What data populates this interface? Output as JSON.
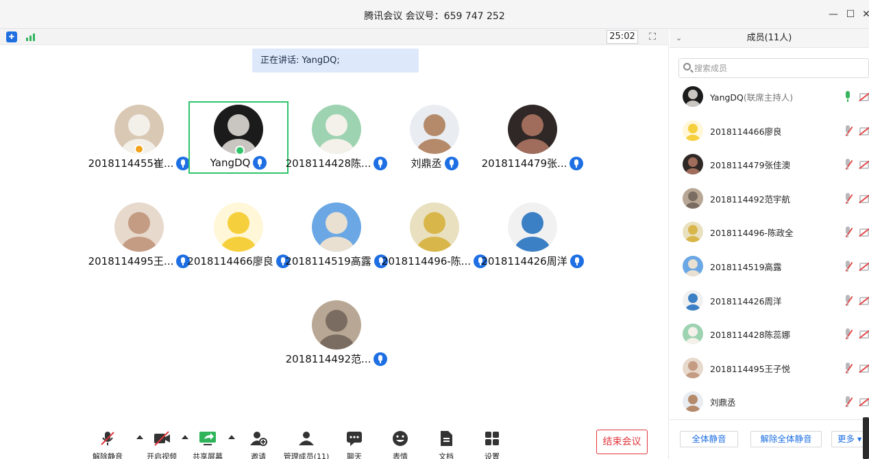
{
  "window": {
    "title": "腾讯会议 会议号：659 747 252"
  },
  "status": {
    "timer": "25:02",
    "speaking": "正在讲话: YangDQ;"
  },
  "tiles": [
    {
      "name": "2018114455崔...",
      "bg": "#d9c8b4",
      "fg": "#f3efe9",
      "badge": "#f2a31b"
    },
    {
      "name": "YangDQ",
      "bg": "#1b1b1b",
      "fg": "#c9c6c2",
      "badge": "#2fc36a"
    },
    {
      "name": "2018114428陈...",
      "bg": "#9dd3b1",
      "fg": "#f4f1ea"
    },
    {
      "name": "刘鼎丞",
      "bg": "#e9edf2",
      "fg": "#b48a6b"
    },
    {
      "name": "2018114479张...",
      "bg": "#2f2826",
      "fg": "#a06d5c"
    },
    {
      "name": "2018114495王...",
      "bg": "#e7d9cc",
      "fg": "#c49b83"
    },
    {
      "name": "2018114466廖良",
      "bg": "#fff7d8",
      "fg": "#f6cf3c"
    },
    {
      "name": "2018114519高露",
      "bg": "#6aa7e4",
      "fg": "#e9e0d2"
    },
    {
      "name": "2018114496-陈...",
      "bg": "#e9e0bf",
      "fg": "#d9b64a"
    },
    {
      "name": "2018114426周洋",
      "bg": "#f1f1f1",
      "fg": "#3b7fc4"
    },
    {
      "name": "2018114492范...",
      "bg": "#b8a794",
      "fg": "#7a6c60"
    }
  ],
  "toolbar": [
    {
      "label": "解除静音",
      "icon": "mic-muted-icon"
    },
    {
      "label": "开启视频",
      "icon": "video-off-icon"
    },
    {
      "label": "共享屏幕",
      "icon": "share-screen-icon"
    },
    {
      "label": "邀请",
      "icon": "invite-icon"
    },
    {
      "label": "管理成员(11)",
      "icon": "members-icon"
    },
    {
      "label": "聊天",
      "icon": "chat-icon"
    },
    {
      "label": "表情",
      "icon": "emoji-icon"
    },
    {
      "label": "文档",
      "icon": "document-icon"
    },
    {
      "label": "设置",
      "icon": "settings-icon"
    }
  ],
  "end_button": "结束会议",
  "panel": {
    "title": "成员(11人)",
    "search_placeholder": "搜索成员",
    "members": [
      {
        "name": "YangDQ",
        "role": "(联席主持人)",
        "bg": "#1b1b1b",
        "fg": "#c9c6c2",
        "mic": "green"
      },
      {
        "name": "2018114466廖良",
        "role": "",
        "bg": "#fff7d8",
        "fg": "#f6cf3c",
        "mic": "muted"
      },
      {
        "name": "2018114479张佳澳",
        "role": "",
        "bg": "#2f2826",
        "fg": "#a06d5c",
        "mic": "muted"
      },
      {
        "name": "2018114492范宇航",
        "role": "",
        "bg": "#b8a794",
        "fg": "#7a6c60",
        "mic": "muted"
      },
      {
        "name": "2018114496-陈政全",
        "role": "",
        "bg": "#e9e0bf",
        "fg": "#d9b64a",
        "mic": "muted"
      },
      {
        "name": "2018114519高露",
        "role": "",
        "bg": "#6aa7e4",
        "fg": "#e9e0d2",
        "mic": "muted"
      },
      {
        "name": "2018114426周洋",
        "role": "",
        "bg": "#f1f1f1",
        "fg": "#3b7fc4",
        "mic": "muted"
      },
      {
        "name": "2018114428陈蕊娜",
        "role": "",
        "bg": "#9dd3b1",
        "fg": "#f4f1ea",
        "mic": "muted"
      },
      {
        "name": "2018114495王子悦",
        "role": "",
        "bg": "#e7d9cc",
        "fg": "#c49b83",
        "mic": "muted"
      },
      {
        "name": "刘鼎丞",
        "role": "",
        "bg": "#e9edf2",
        "fg": "#b48a6b",
        "mic": "muted"
      }
    ],
    "footer": {
      "mute_all": "全体静音",
      "unmute_all": "解除全体静音",
      "more": "更多"
    }
  }
}
